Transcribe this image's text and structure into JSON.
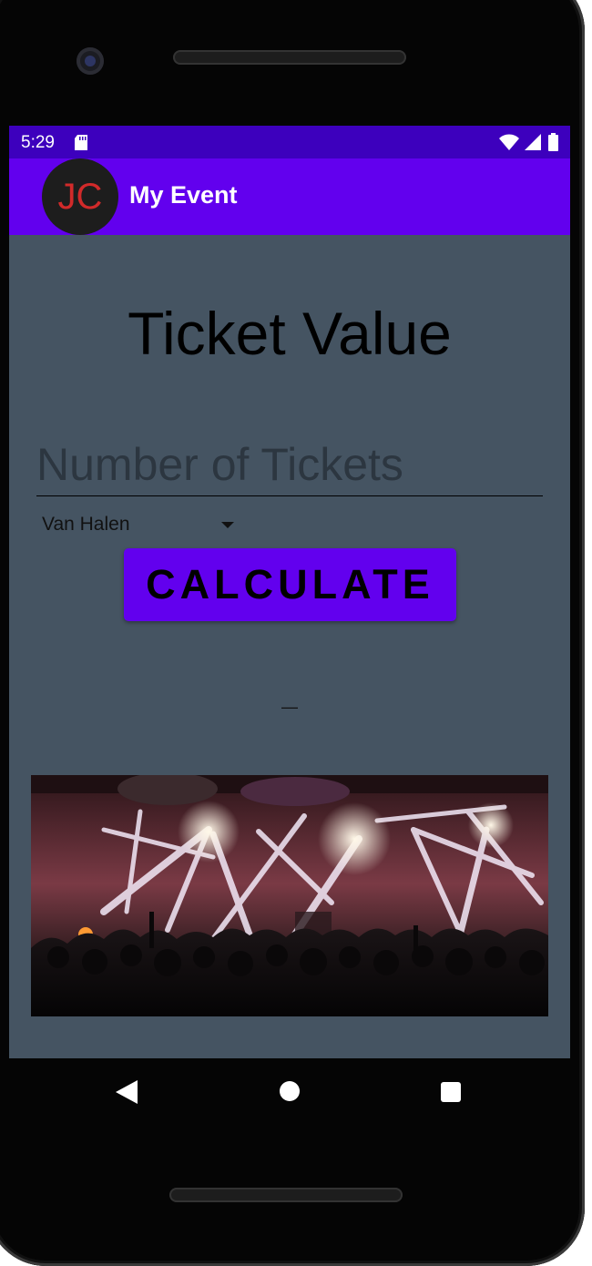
{
  "status_bar": {
    "time": "5:29",
    "icons": [
      "sd-card-icon",
      "wifi-icon",
      "signal-icon",
      "battery-icon"
    ]
  },
  "app_bar": {
    "avatar_initials": "JC",
    "title": "My Event"
  },
  "main": {
    "title": "Ticket Value",
    "tickets_input": {
      "value": "",
      "placeholder": "Number of Tickets"
    },
    "band_select": {
      "selected": "Van Halen"
    },
    "calculate_label": "CALCULATE",
    "result": "—"
  },
  "colors": {
    "status_bar": "#3d00bd",
    "app_bar": "#6200ee",
    "button": "#6200ee",
    "background": "#455462",
    "avatar_bg": "#1d1d1d",
    "avatar_text": "#d12a2a"
  },
  "nav_bar": {
    "icons": [
      "back-icon",
      "home-icon",
      "recents-icon"
    ]
  }
}
